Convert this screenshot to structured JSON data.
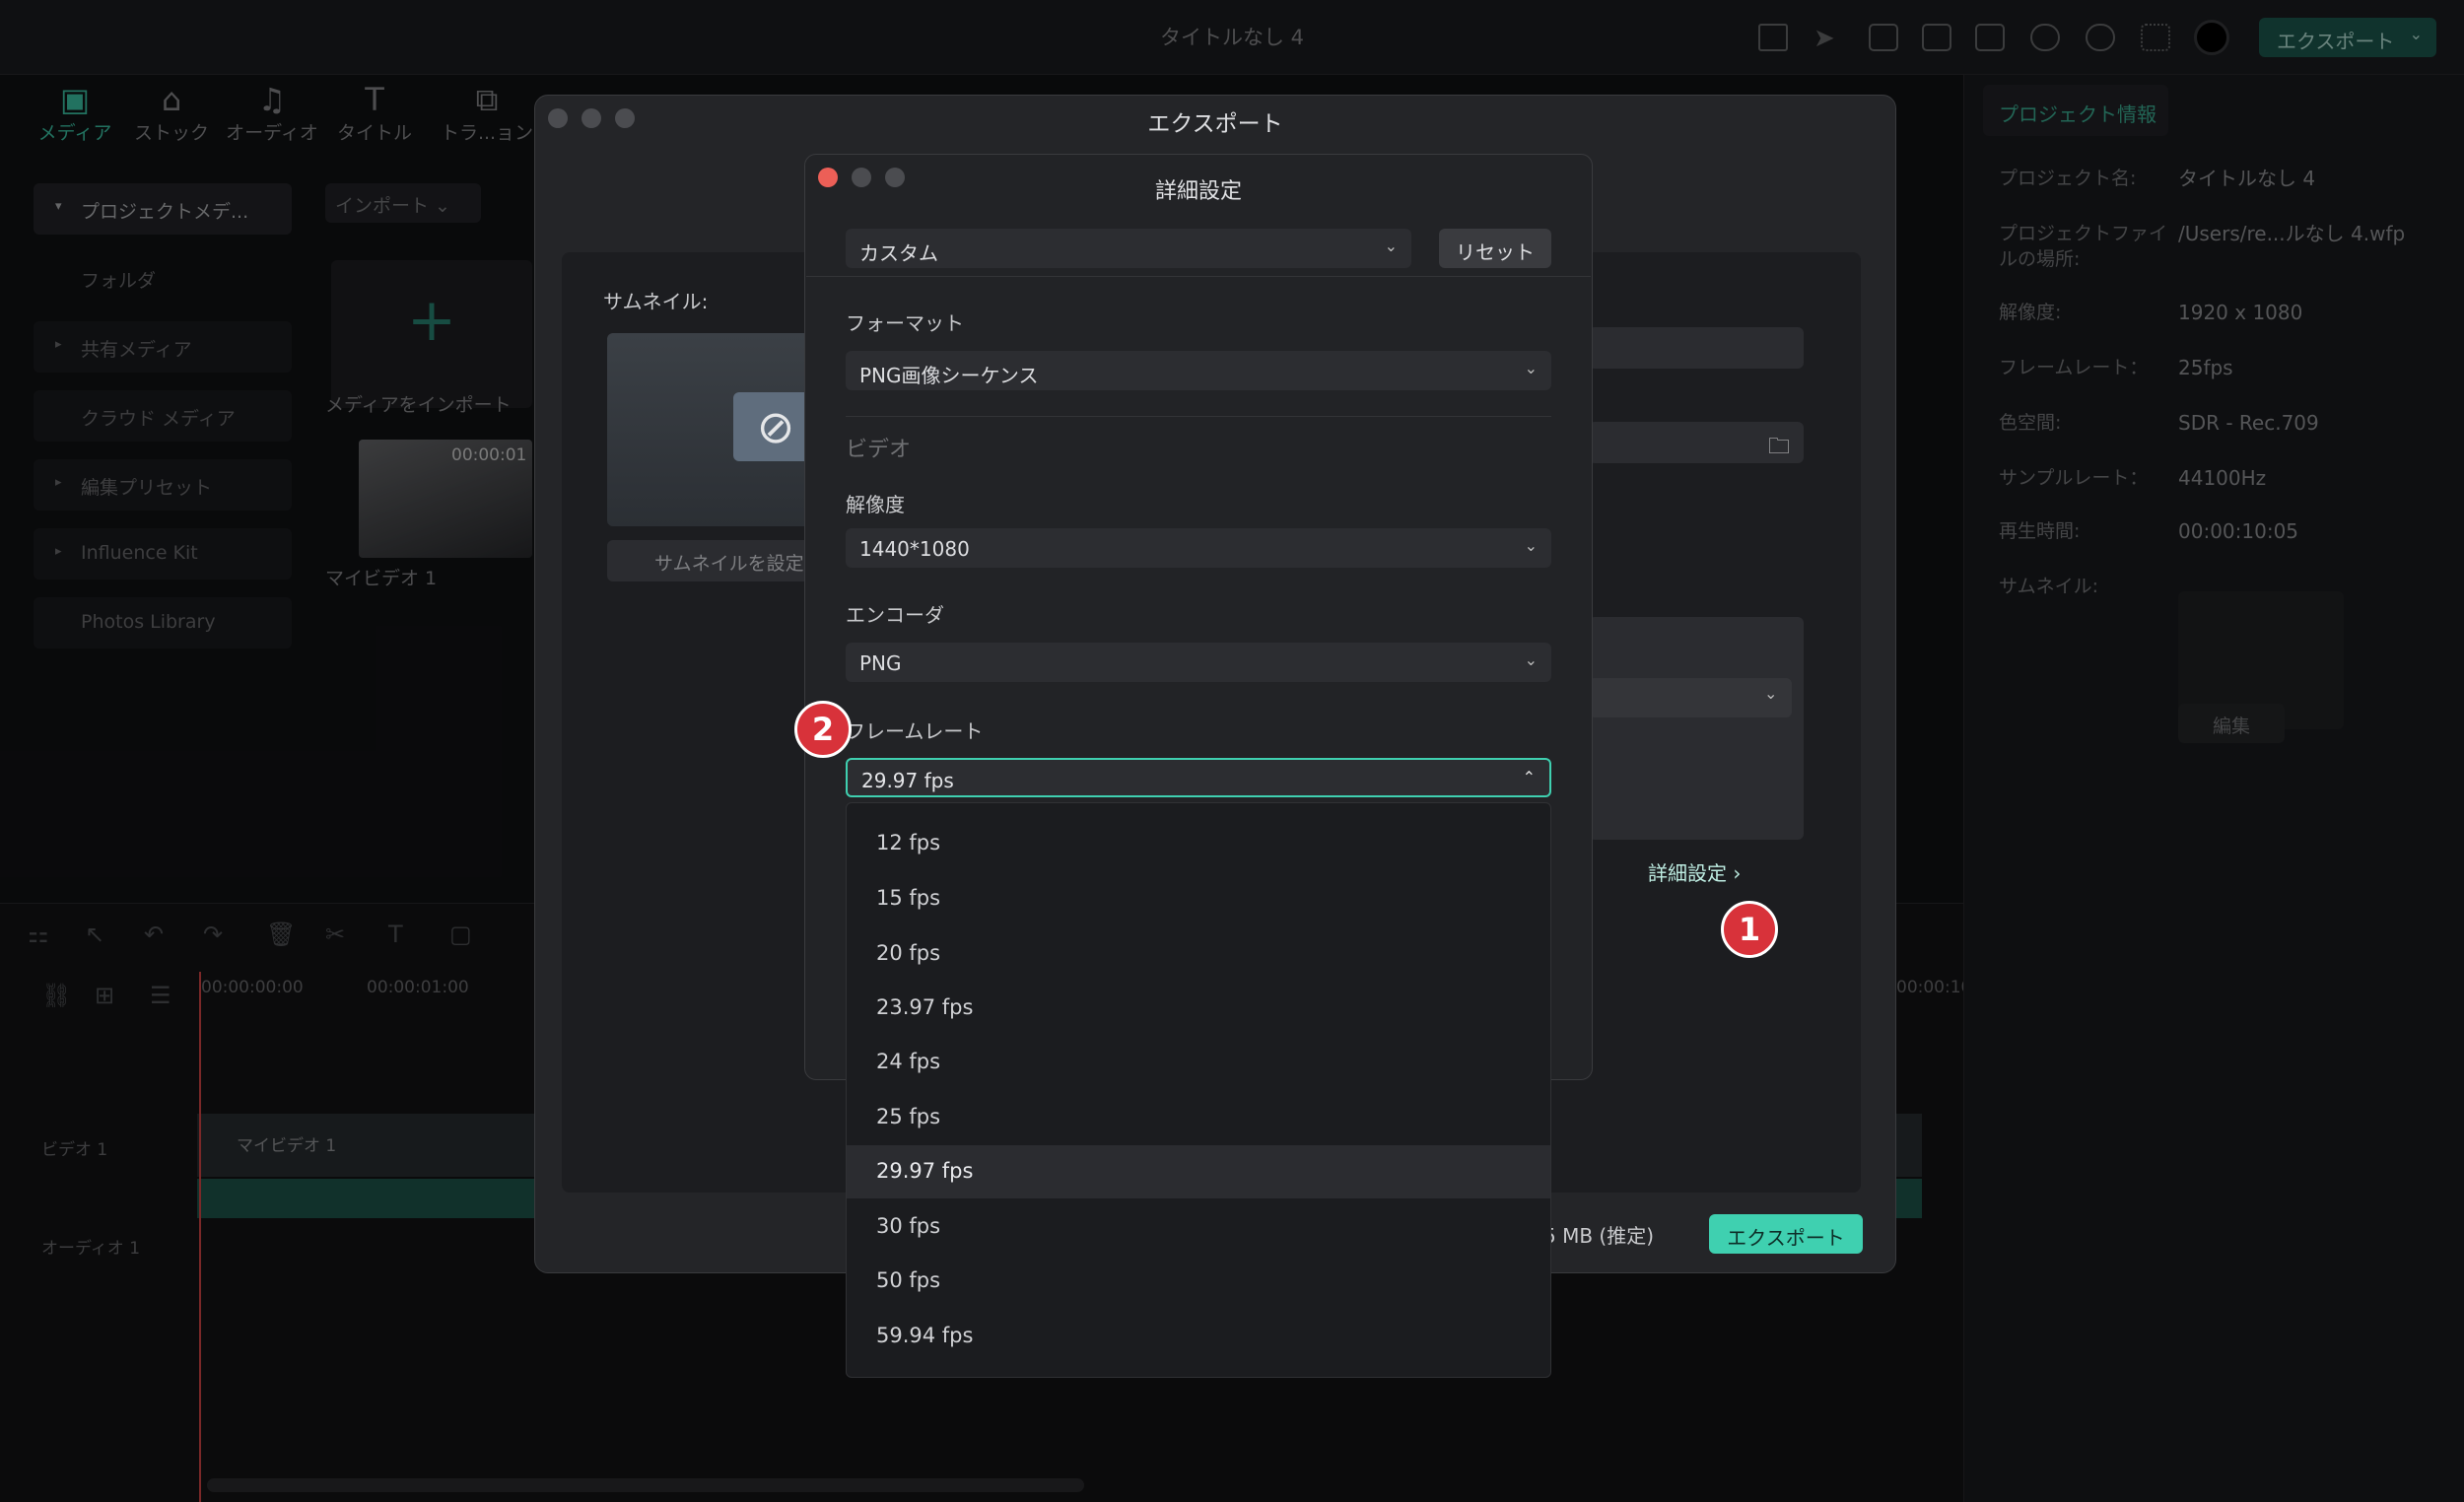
{
  "app_title": "タイトルなし 4",
  "top_export_label": "エクスポート",
  "toolbar": [
    {
      "label": "メディア",
      "glyph": "▣"
    },
    {
      "label": "ストック",
      "glyph": "⌂"
    },
    {
      "label": "オーディオ",
      "glyph": "♫"
    },
    {
      "label": "タイトル",
      "glyph": "T"
    },
    {
      "label": "トラ...ョン",
      "glyph": "⧉"
    }
  ],
  "sidebar": {
    "items": [
      "プロジェクトメデ...",
      "フォルダ",
      "共有メディア",
      "クラウド メディア",
      "編集プリセット",
      "Influence Kit",
      "Photos Library"
    ]
  },
  "media": {
    "import_label": "インポート",
    "import_media_label": "メディアをインポート",
    "thumb_duration": "00:00:01",
    "video_label": "マイビデオ 1"
  },
  "timeline": {
    "times": [
      "00:00:00:00",
      "00:00:01:00"
    ],
    "track_video": "ビデオ 1",
    "track_audio": "オーディオ 1",
    "right_time": "00:00:10:",
    "clip_label": "マイビデオ 1"
  },
  "project_info": {
    "tab_label": "プロジェクト情報",
    "rows": [
      {
        "key": "プロジェクト名:",
        "value": "タイトルなし 4"
      },
      {
        "key": "プロジェクトファイルの場所:",
        "value": "/Users/re...ルなし 4.wfp"
      },
      {
        "key": "解像度:",
        "value": "1920 x 1080"
      },
      {
        "key": "フレームレート：",
        "value": "25fps"
      },
      {
        "key": "色空間:",
        "value": "SDR - Rec.709"
      },
      {
        "key": "サンプルレート：",
        "value": "44100Hz"
      },
      {
        "key": "再生時間:",
        "value": "00:00:10:05"
      },
      {
        "key": "サムネイル:",
        "value": ""
      }
    ],
    "edit_label": "編集"
  },
  "export_dialog": {
    "title": "エクスポート",
    "thumbnail_label": "サムネイル:",
    "set_thumbnail_label": "サムネイルを設定",
    "advanced_link": "詳細設定 ›",
    "size_estimate": "5 MB (推定)",
    "export_button": "エクスポート"
  },
  "advanced_dialog": {
    "title": "詳細設定",
    "preset": "カスタム",
    "reset_label": "リセット",
    "format_label": "フォーマット",
    "format_value": "PNG画像シーケンス",
    "video_header": "ビデオ",
    "resolution_label": "解像度",
    "resolution_value": "1440*1080",
    "encoder_label": "エンコーダ",
    "encoder_value": "PNG",
    "framerate_label": "フレームレート",
    "framerate_value": "29.97 fps",
    "fps_options": [
      "12 fps",
      "15 fps",
      "20 fps",
      "23.97 fps",
      "24 fps",
      "25 fps",
      "29.97 fps",
      "30 fps",
      "50 fps",
      "59.94 fps"
    ],
    "selected_index": 6
  },
  "badges": [
    "1",
    "2"
  ],
  "colors": {
    "accent": "#3fd0b0",
    "badge": "#d8323a",
    "close_dot": "#ec5f57"
  }
}
